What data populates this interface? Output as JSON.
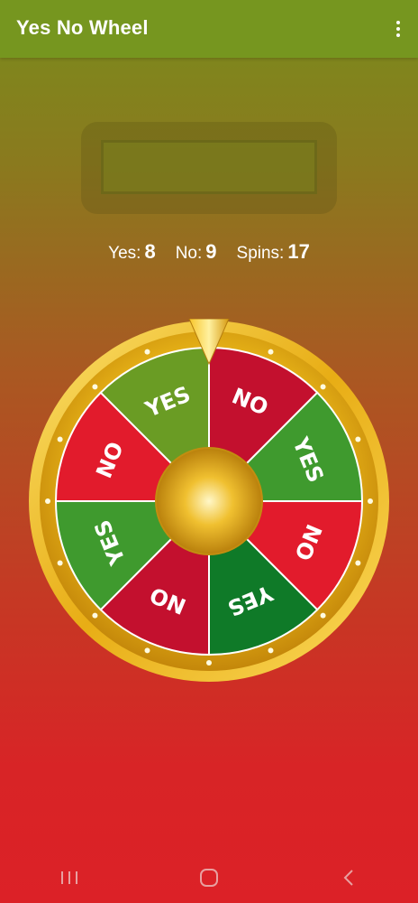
{
  "app": {
    "title": "Yes No Wheel"
  },
  "result": {
    "text": ""
  },
  "stats": {
    "yes_label": "Yes:",
    "yes_count": "8",
    "no_label": "No:",
    "no_count": "9",
    "spins_label": "Spins:",
    "spins_count": "17"
  },
  "wheel": {
    "segments": [
      {
        "label": "NO",
        "color": "#c3102e"
      },
      {
        "label": "YES",
        "color": "#3f9a2e"
      },
      {
        "label": "NO",
        "color": "#e21b2c"
      },
      {
        "label": "YES",
        "color": "#0f7a28"
      },
      {
        "label": "NO",
        "color": "#c3102e"
      },
      {
        "label": "YES",
        "color": "#3f9a2e"
      },
      {
        "label": "NO",
        "color": "#e21b2c"
      },
      {
        "label": "YES",
        "color": "#6a9c24"
      }
    ]
  },
  "icons": {
    "menu": "more-vert-icon",
    "recents": "recents-icon",
    "home": "home-icon",
    "back": "back-icon"
  }
}
